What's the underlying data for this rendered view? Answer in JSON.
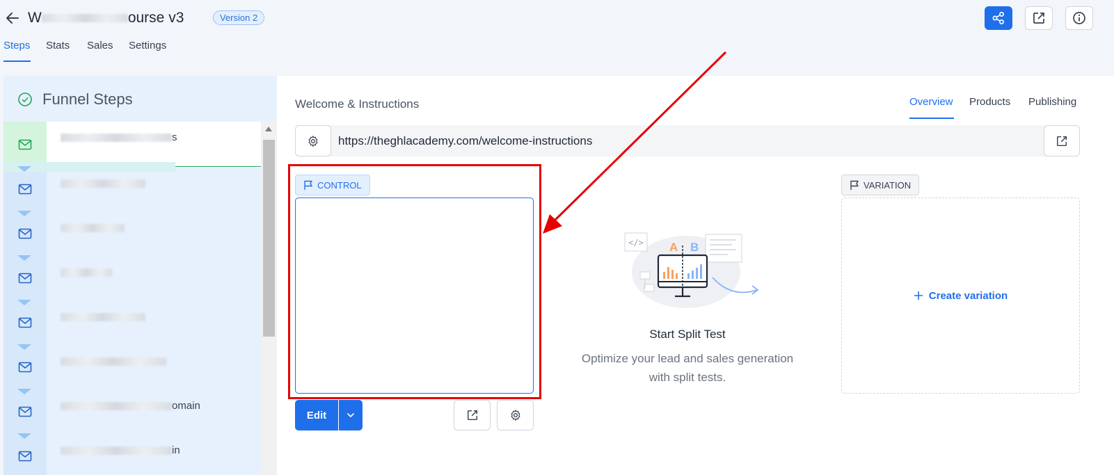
{
  "header": {
    "title_start": "W",
    "title_end": "ourse v3",
    "version_badge": "Version 2",
    "buttons": [
      "share-icon",
      "open-external-icon",
      "info-icon"
    ]
  },
  "top_tabs": [
    {
      "label": "Steps",
      "active": true
    },
    {
      "label": "Stats",
      "active": false
    },
    {
      "label": "Sales",
      "active": false
    },
    {
      "label": "Settings",
      "active": false
    }
  ],
  "sidebar": {
    "title": "Funnel Steps",
    "steps": [
      {
        "label_suffix": "s",
        "active": true
      },
      {
        "label_suffix": "",
        "active": false
      },
      {
        "label_suffix": "",
        "active": false
      },
      {
        "label_suffix": "",
        "active": false
      },
      {
        "label_suffix": "",
        "active": false
      },
      {
        "label_suffix": "",
        "active": false
      },
      {
        "label_suffix": "omain",
        "active": false
      },
      {
        "label_suffix": "in",
        "active": false
      }
    ]
  },
  "main": {
    "page_title": "Welcome & Instructions",
    "right_tabs": [
      {
        "label": "Overview",
        "active": true
      },
      {
        "label": "Products",
        "active": false
      },
      {
        "label": "Publishing",
        "active": false
      }
    ],
    "url": "https://theghlacademy.com/welcome-instructions",
    "control_label": "CONTROL",
    "edit_label": "Edit",
    "split_title": "Start Split Test",
    "split_desc_line1": "Optimize your lead and sales generation",
    "split_desc_line2": "with split tests.",
    "variation_label": "VARIATION",
    "create_variation": "Create variation",
    "illustration_letters": {
      "a": "A",
      "b": "B"
    }
  },
  "colors": {
    "accent": "#1f6feb",
    "annotation": "#e60000",
    "sidebar_bg": "#e6f1fd",
    "active_step": "#d4f4dd"
  }
}
